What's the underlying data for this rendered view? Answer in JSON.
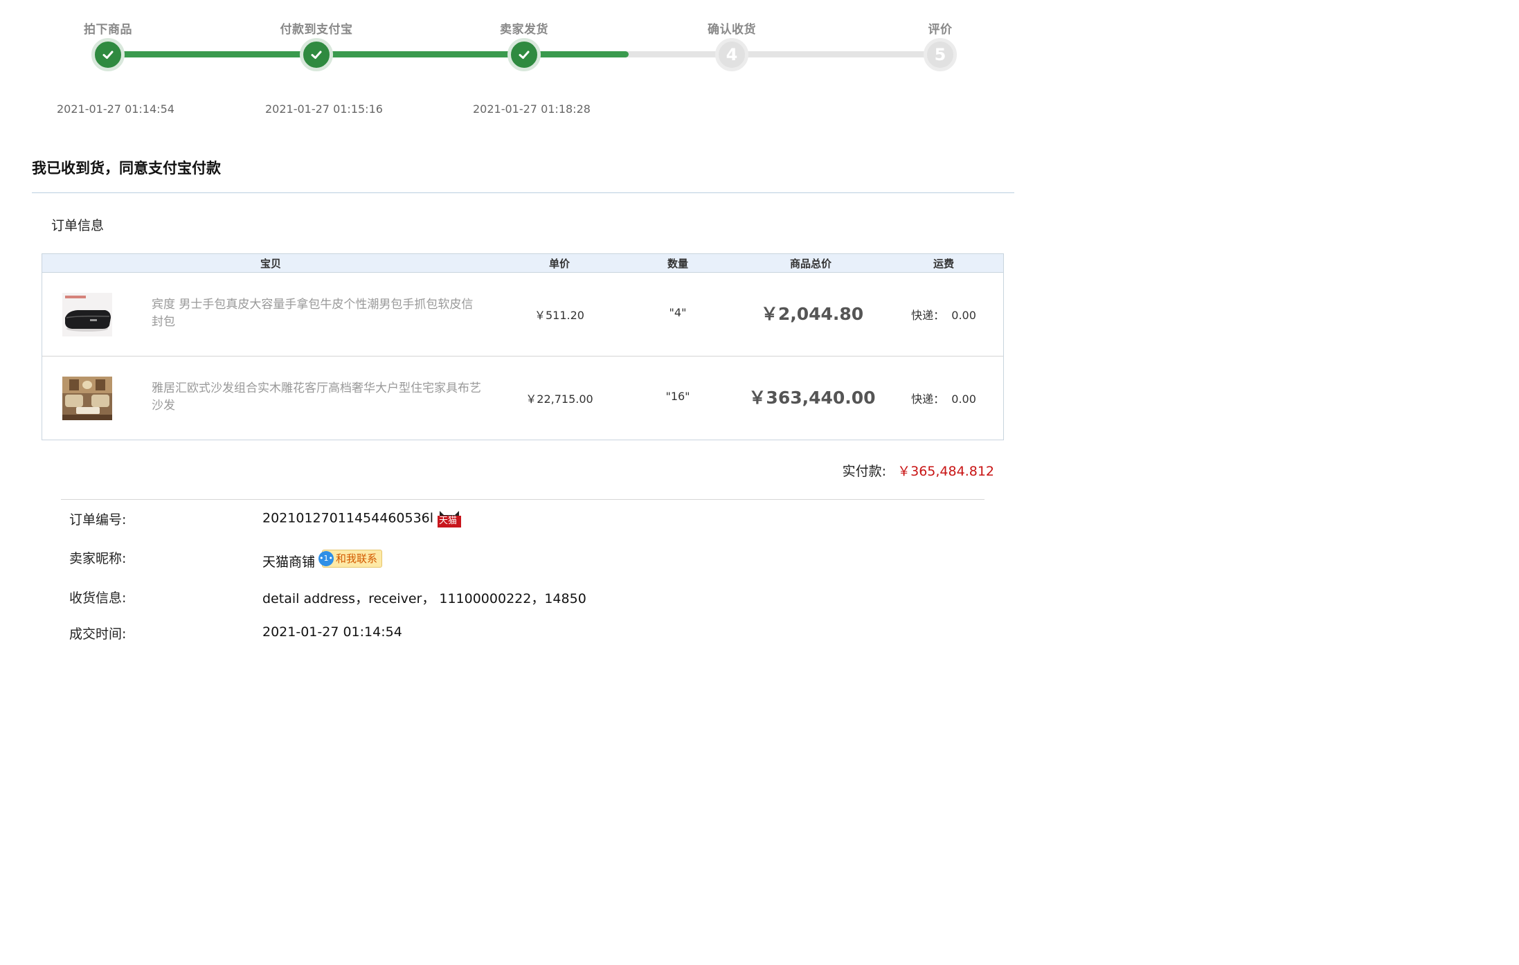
{
  "progress": {
    "steps": [
      {
        "label": "拍下商品",
        "number": "1",
        "status": "done",
        "time": "2021-01-27 01:14:54"
      },
      {
        "label": "付款到支付宝",
        "number": "2",
        "status": "done",
        "time": "2021-01-27 01:15:16"
      },
      {
        "label": "卖家发货",
        "number": "3",
        "status": "done",
        "time": "2021-01-27 01:18:28"
      },
      {
        "label": "确认收货",
        "number": "4",
        "status": "pending",
        "time": ""
      },
      {
        "label": "评价",
        "number": "5",
        "status": "pending",
        "time": ""
      }
    ],
    "completed_fraction": 0.625
  },
  "headline": "我已收到货，同意支付宝付款",
  "order_section": {
    "title": "订单信息",
    "columns": {
      "item": "宝贝",
      "unit_price": "单价",
      "quantity": "数量",
      "total": "商品总价",
      "shipping": "运费"
    },
    "rows": [
      {
        "name": "宾度 男士手包真皮大容量手拿包牛皮个性潮男包手抓包软皮信封包",
        "thumb_icon": "clutch-bag-photo",
        "unit_price": "￥511.20",
        "quantity": "\"4\"",
        "total": "￥2,044.80",
        "shipping": "快递：  0.00"
      },
      {
        "name": "雅居汇欧式沙发组合实木雕花客厅高档奢华大户型住宅家具布艺沙发",
        "thumb_icon": "sofa-set-photo",
        "unit_price": "￥22,715.00",
        "quantity": "\"16\"",
        "total": "￥363,440.00",
        "shipping": "快递：  0.00"
      }
    ]
  },
  "payment": {
    "label": "实付款:",
    "amount": "￥365,484.812"
  },
  "info": {
    "order_no_label": "订单编号:",
    "order_no": "20210127011454460536l",
    "tmall_badge": "天猫",
    "seller_label": "卖家昵称:",
    "seller": "天猫商铺",
    "contact_label": "和我联系",
    "address_label": "收货信息:",
    "address": "detail address，receiver， 11100000222，14850",
    "time_label": "成交时间:",
    "time": "2021-01-27 01:14:54"
  },
  "colors": {
    "done": "#2f8a40",
    "pending": "#e1e1e1",
    "price_red": "#c81414",
    "header_bg": "#e8f0fa"
  }
}
